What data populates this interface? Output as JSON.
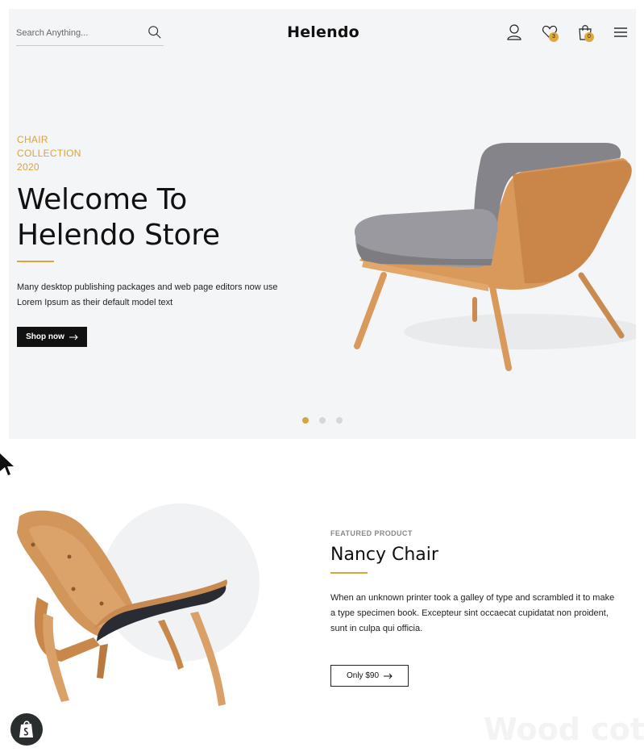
{
  "header": {
    "search_placeholder": "Search Anything...",
    "logo": "Helendo",
    "wishlist_count": "3",
    "cart_count": "0"
  },
  "hero": {
    "eyebrow": [
      "CHAIR",
      "COLLECTION",
      "2020"
    ],
    "title_lines": [
      "Welcome To",
      "Helendo Store"
    ],
    "description_lines": [
      "Many desktop publishing packages and web page editors now use",
      "Lorem Ipsum as their default model text"
    ],
    "cta_label": "Shop now",
    "slides": 3,
    "active_slide": 1
  },
  "featured": {
    "label": "FEATURED PRODUCT",
    "title": "Nancy Chair",
    "description": "When an unknown printer took a galley of type and scrambled it to make a type specimen book. Excepteur sint occaecat cupidatat non proident, sunt in culpa qui officia.",
    "price_label": "Only $90"
  },
  "watermark": "Wood coth",
  "colors": {
    "accent": "#d9a33e",
    "hero_bg": "#f4f5f7",
    "dark": "#111111"
  },
  "icons": [
    "search-icon",
    "user-icon",
    "heart-icon",
    "shopping-bag-icon",
    "menu-icon",
    "arrow-right-icon",
    "shopify-icon"
  ]
}
